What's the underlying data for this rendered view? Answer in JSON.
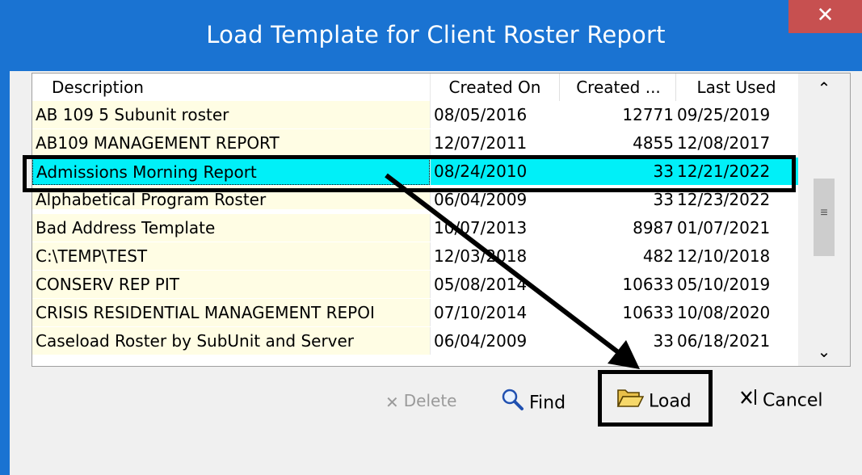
{
  "window": {
    "title": "Load Template for Client Roster Report",
    "close_glyph": "✕"
  },
  "list": {
    "columns": [
      "Description",
      "Created On",
      "Created ...",
      "Last Used"
    ],
    "rows": [
      {
        "description": "AB 109 5 Subunit roster",
        "created_on": "08/05/2016",
        "created_by": "12771",
        "last_used": "09/25/2019"
      },
      {
        "description": "AB109 MANAGEMENT REPORT",
        "created_on": "12/07/2011",
        "created_by": "4855",
        "last_used": "12/08/2017"
      },
      {
        "description": "Admissions Morning Report",
        "created_on": "08/24/2010",
        "created_by": "33",
        "last_used": "12/21/2022"
      },
      {
        "description": "Alphabetical Program Roster",
        "created_on": "06/04/2009",
        "created_by": "33",
        "last_used": "12/23/2022"
      },
      {
        "description": "Bad Address Template",
        "created_on": "10/07/2013",
        "created_by": "8987",
        "last_used": "01/07/2021"
      },
      {
        "description": "C:\\TEMP\\TEST",
        "created_on": "12/03/2018",
        "created_by": "482",
        "last_used": "12/10/2018"
      },
      {
        "description": "CONSERV REP PIT",
        "created_on": "05/08/2014",
        "created_by": "10633",
        "last_used": "05/10/2019"
      },
      {
        "description": "CRISIS RESIDENTIAL MANAGEMENT REPOI",
        "created_on": "07/10/2014",
        "created_by": "10633",
        "last_used": "10/08/2020"
      },
      {
        "description": "Caseload Roster by SubUnit and Server",
        "created_on": "06/04/2009",
        "created_by": "33",
        "last_used": "06/18/2021"
      }
    ],
    "selected_index": 2
  },
  "scrollbar": {
    "up_glyph": "⌃",
    "down_glyph": "⌄",
    "grip_glyph": "≡"
  },
  "buttons": {
    "delete": {
      "glyph": "✕",
      "label": "Delete",
      "enabled": false
    },
    "find": {
      "label": "Find"
    },
    "load": {
      "label": "Load"
    },
    "cancel": {
      "label": "Cancel"
    }
  },
  "colors": {
    "titlebar": "#1a73d2",
    "close": "#c75050",
    "selection": "#00f0f8",
    "description_column": "#fffde4"
  }
}
